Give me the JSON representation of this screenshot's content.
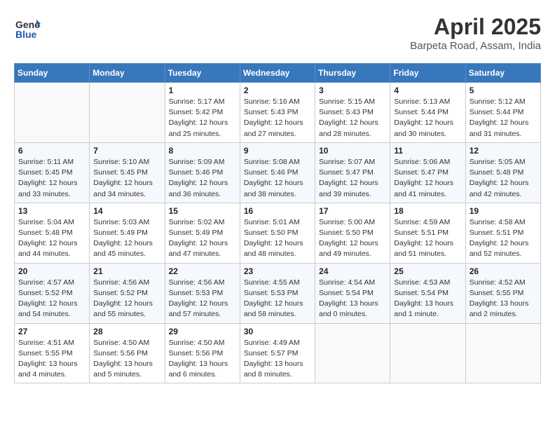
{
  "header": {
    "logo_general": "General",
    "logo_blue": "Blue",
    "title": "April 2025",
    "subtitle": "Barpeta Road, Assam, India"
  },
  "days_of_week": [
    "Sunday",
    "Monday",
    "Tuesday",
    "Wednesday",
    "Thursday",
    "Friday",
    "Saturday"
  ],
  "weeks": [
    [
      {
        "day": "",
        "info": ""
      },
      {
        "day": "",
        "info": ""
      },
      {
        "day": "1",
        "info": "Sunrise: 5:17 AM\nSunset: 5:42 PM\nDaylight: 12 hours and 25 minutes."
      },
      {
        "day": "2",
        "info": "Sunrise: 5:16 AM\nSunset: 5:43 PM\nDaylight: 12 hours and 27 minutes."
      },
      {
        "day": "3",
        "info": "Sunrise: 5:15 AM\nSunset: 5:43 PM\nDaylight: 12 hours and 28 minutes."
      },
      {
        "day": "4",
        "info": "Sunrise: 5:13 AM\nSunset: 5:44 PM\nDaylight: 12 hours and 30 minutes."
      },
      {
        "day": "5",
        "info": "Sunrise: 5:12 AM\nSunset: 5:44 PM\nDaylight: 12 hours and 31 minutes."
      }
    ],
    [
      {
        "day": "6",
        "info": "Sunrise: 5:11 AM\nSunset: 5:45 PM\nDaylight: 12 hours and 33 minutes."
      },
      {
        "day": "7",
        "info": "Sunrise: 5:10 AM\nSunset: 5:45 PM\nDaylight: 12 hours and 34 minutes."
      },
      {
        "day": "8",
        "info": "Sunrise: 5:09 AM\nSunset: 5:46 PM\nDaylight: 12 hours and 36 minutes."
      },
      {
        "day": "9",
        "info": "Sunrise: 5:08 AM\nSunset: 5:46 PM\nDaylight: 12 hours and 38 minutes."
      },
      {
        "day": "10",
        "info": "Sunrise: 5:07 AM\nSunset: 5:47 PM\nDaylight: 12 hours and 39 minutes."
      },
      {
        "day": "11",
        "info": "Sunrise: 5:06 AM\nSunset: 5:47 PM\nDaylight: 12 hours and 41 minutes."
      },
      {
        "day": "12",
        "info": "Sunrise: 5:05 AM\nSunset: 5:48 PM\nDaylight: 12 hours and 42 minutes."
      }
    ],
    [
      {
        "day": "13",
        "info": "Sunrise: 5:04 AM\nSunset: 5:48 PM\nDaylight: 12 hours and 44 minutes."
      },
      {
        "day": "14",
        "info": "Sunrise: 5:03 AM\nSunset: 5:49 PM\nDaylight: 12 hours and 45 minutes."
      },
      {
        "day": "15",
        "info": "Sunrise: 5:02 AM\nSunset: 5:49 PM\nDaylight: 12 hours and 47 minutes."
      },
      {
        "day": "16",
        "info": "Sunrise: 5:01 AM\nSunset: 5:50 PM\nDaylight: 12 hours and 48 minutes."
      },
      {
        "day": "17",
        "info": "Sunrise: 5:00 AM\nSunset: 5:50 PM\nDaylight: 12 hours and 49 minutes."
      },
      {
        "day": "18",
        "info": "Sunrise: 4:59 AM\nSunset: 5:51 PM\nDaylight: 12 hours and 51 minutes."
      },
      {
        "day": "19",
        "info": "Sunrise: 4:58 AM\nSunset: 5:51 PM\nDaylight: 12 hours and 52 minutes."
      }
    ],
    [
      {
        "day": "20",
        "info": "Sunrise: 4:57 AM\nSunset: 5:52 PM\nDaylight: 12 hours and 54 minutes."
      },
      {
        "day": "21",
        "info": "Sunrise: 4:56 AM\nSunset: 5:52 PM\nDaylight: 12 hours and 55 minutes."
      },
      {
        "day": "22",
        "info": "Sunrise: 4:56 AM\nSunset: 5:53 PM\nDaylight: 12 hours and 57 minutes."
      },
      {
        "day": "23",
        "info": "Sunrise: 4:55 AM\nSunset: 5:53 PM\nDaylight: 12 hours and 58 minutes."
      },
      {
        "day": "24",
        "info": "Sunrise: 4:54 AM\nSunset: 5:54 PM\nDaylight: 13 hours and 0 minutes."
      },
      {
        "day": "25",
        "info": "Sunrise: 4:53 AM\nSunset: 5:54 PM\nDaylight: 13 hours and 1 minute."
      },
      {
        "day": "26",
        "info": "Sunrise: 4:52 AM\nSunset: 5:55 PM\nDaylight: 13 hours and 2 minutes."
      }
    ],
    [
      {
        "day": "27",
        "info": "Sunrise: 4:51 AM\nSunset: 5:55 PM\nDaylight: 13 hours and 4 minutes."
      },
      {
        "day": "28",
        "info": "Sunrise: 4:50 AM\nSunset: 5:56 PM\nDaylight: 13 hours and 5 minutes."
      },
      {
        "day": "29",
        "info": "Sunrise: 4:50 AM\nSunset: 5:56 PM\nDaylight: 13 hours and 6 minutes."
      },
      {
        "day": "30",
        "info": "Sunrise: 4:49 AM\nSunset: 5:57 PM\nDaylight: 13 hours and 8 minutes."
      },
      {
        "day": "",
        "info": ""
      },
      {
        "day": "",
        "info": ""
      },
      {
        "day": "",
        "info": ""
      }
    ]
  ]
}
